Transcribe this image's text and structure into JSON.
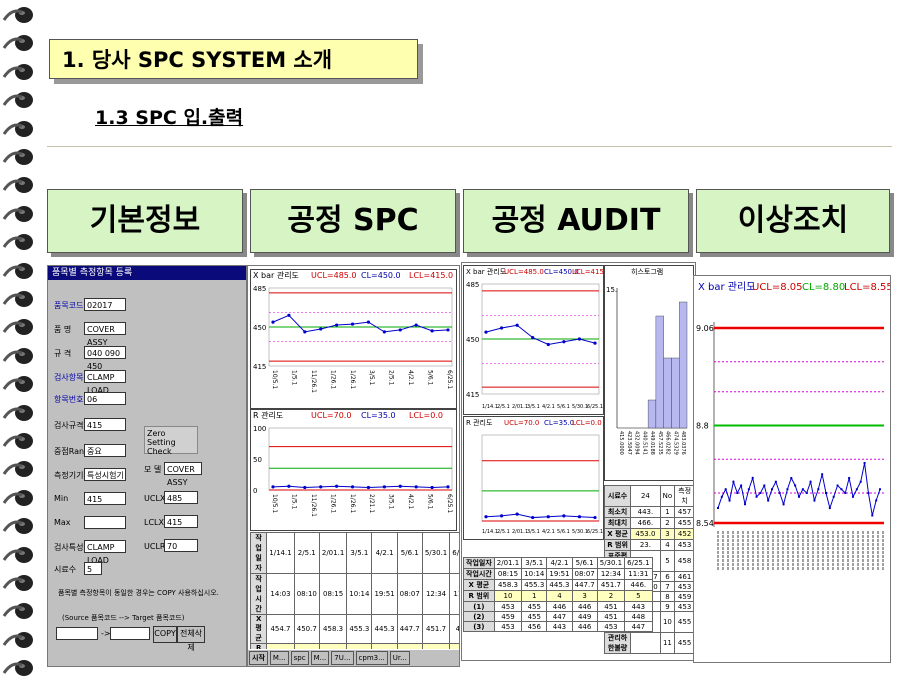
{
  "slide": {
    "title": "1. 당사 SPC SYSTEM 소개",
    "subtitle": "1.3  SPC 입.출력"
  },
  "categories": [
    "기본정보",
    "공정 SPC",
    "공정 AUDIT",
    "이상조치"
  ],
  "form": {
    "window_title": "품목별 측정항목 등록",
    "fields": [
      {
        "label": "품목코드",
        "value": "02017"
      },
      {
        "label": "품 명",
        "value": "COVER ASSY"
      },
      {
        "label": "규 격",
        "value": "040 090 450"
      },
      {
        "label": "검사항목",
        "value": "CLAMP LOAD"
      },
      {
        "label": "항목번호",
        "value": "06"
      },
      {
        "label": "검사규격",
        "value": "415"
      },
      {
        "label": "중점Rank",
        "value": "중요"
      },
      {
        "label": "측정기기",
        "value": "특성시험기"
      },
      {
        "label": "Min",
        "value": "415"
      },
      {
        "label": "Max",
        "value": ""
      },
      {
        "label": "검사특성",
        "value": "CLAMP LOAD"
      },
      {
        "label": "시료수",
        "value": "5"
      }
    ],
    "zero_check": "Zero Setting Check",
    "model_label": "모 델 명",
    "model_value": "COVER ASSY",
    "ucl_label": "UCLX",
    "ucl_value": "485",
    "lcl_label": "LCLX",
    "lcl_value": "415",
    "uclr_label": "UCLR",
    "uclr_value": "70",
    "note": "품목별 측정항목이 동일한 경우는 COPY 사용하십시오.",
    "copy_hint": "(Source 품목코드 --> Target 품목코드)",
    "arrow": "->",
    "copy_button": "COPY",
    "delete_button": "전체삭제"
  },
  "spc": {
    "xbar": {
      "title": "X bar 관리도",
      "ucl": "UCL=485.0",
      "cl": "CL=450.0",
      "lcl": "LCL=415.0",
      "y_ticks": [
        "485",
        "450",
        "415"
      ],
      "x_ticks": [
        "10/5.1",
        "1/5.1",
        "11/26.1",
        "1/26.1",
        "1/26.1",
        "3/5.1",
        "2/5.1",
        "4/2.1",
        "5/6.1",
        "6/25.1"
      ]
    },
    "r": {
      "title": "R 관리도",
      "ucl": "UCL=70.0",
      "cl": "CL=35.0",
      "lcl": "LCL=0.0",
      "y_ticks": [
        "100",
        "50",
        "0"
      ],
      "x_ticks": [
        "10/5.1",
        "1/5.1",
        "11/26.1",
        "1/26.1",
        "1/26.1",
        "2/21.1",
        "3/5.1",
        "4/2.1",
        "5/6.1",
        "6/25.1"
      ]
    },
    "table": {
      "rows": [
        [
          "작업일자",
          "1/14.1",
          "2/5.1",
          "2/01.1",
          "3/5.1",
          "4/2.1",
          "5/6.1",
          "5/30.1",
          "6/25.1"
        ],
        [
          "작업시간",
          "14:03",
          "08:10",
          "08:15",
          "10:14",
          "19:51",
          "08:07",
          "12:34",
          "11:31"
        ],
        [
          "X 평균",
          "454.7",
          "450.7",
          "458.3",
          "455.3",
          "445.3",
          "447.7",
          "451.7",
          "446."
        ],
        [
          "R 범위",
          "5",
          "5",
          "10",
          "1",
          "4",
          "3",
          "2",
          "5"
        ],
        [
          "(1)",
          "457",
          "453",
          "453",
          "455",
          "446",
          "446",
          "451",
          "443"
        ],
        [
          "(2)",
          "455",
          "458",
          "459",
          "455",
          "447",
          "449",
          "451",
          "448"
        ],
        [
          "(3)",
          "452",
          "461",
          "453",
          "456",
          "443",
          "446",
          "453",
          "447"
        ]
      ]
    },
    "taskbar": [
      "시작",
      "M...",
      "spc",
      "M...",
      "7U...",
      "cpm3...",
      "Ur..."
    ]
  },
  "audit": {
    "xbar": {
      "title": "X bar 관리도",
      "ucl": "UCL=485.0",
      "cl": "CL=450.0",
      "lcl": "LCL=415.0",
      "y_ticks": [
        "485",
        "450",
        "415"
      ],
      "x_ticks": [
        "1/14.1",
        "2/5.1",
        "2/01.1",
        "3/5.1",
        "4/2.1",
        "5/6.1",
        "5/30.1",
        "6/25.1"
      ]
    },
    "r": {
      "title": "R 관리도",
      "ucl": "UCL=70.0",
      "cl": "CL=35.0",
      "lcl": "LCL=0.0",
      "x_ticks": [
        "1/14.1",
        "2/5.1",
        "2/01.1",
        "3/5.1",
        "4/2.1",
        "5/6.1",
        "5/30.1",
        "6/25.1"
      ]
    },
    "hist": {
      "title": "히스토그램",
      "y_top": "15.",
      "x_ticks": [
        "415.0000",
        "423.5047",
        "432.0094",
        "440.5141",
        "449.0188",
        "457.5235",
        "466.0282",
        "474.5329",
        "483.0376"
      ]
    },
    "stats": [
      [
        "시료수",
        "24",
        "No",
        "측정치"
      ],
      [
        "최소치",
        "443.",
        "1",
        "457"
      ],
      [
        "최대치",
        "466.",
        "2",
        "455"
      ],
      [
        "X 평균",
        "453.0",
        "3",
        "452"
      ],
      [
        "R 범위",
        "23.",
        "4",
        "453"
      ],
      [
        "표준편차",
        "7.25",
        "5",
        "458"
      ],
      [
        "-3S",
        "431.87",
        "6",
        "461"
      ],
      [
        "+3S",
        "475.30",
        "7",
        "453"
      ],
      [
        "Cp",
        "1.78",
        "8",
        "459"
      ],
      [
        "Cpk",
        "",
        "9",
        "453"
      ],
      [
        "관리상한불량",
        "",
        "10",
        "455"
      ],
      [
        "관리하한불량",
        "",
        "11",
        "455"
      ]
    ],
    "table": {
      "rows": [
        [
          "작업일자",
          "2/01.1",
          "3/5.1",
          "4/2.1",
          "5/6.1",
          "5/30.1",
          "6/25.1"
        ],
        [
          "작업시간",
          "08:15",
          "10:14",
          "19:51",
          "08:07",
          "12:34",
          "11:31"
        ],
        [
          "X 평균",
          "458.3",
          "455.3",
          "445.3",
          "447.7",
          "451.7",
          "446."
        ],
        [
          "R 범위",
          "10",
          "1",
          "4",
          "3",
          "2",
          "5"
        ],
        [
          "(1)",
          "453",
          "455",
          "446",
          "446",
          "451",
          "443"
        ],
        [
          "(2)",
          "459",
          "455",
          "447",
          "449",
          "451",
          "448"
        ],
        [
          "(3)",
          "453",
          "456",
          "443",
          "446",
          "453",
          "447"
        ]
      ]
    }
  },
  "abnormal": {
    "title": "X bar 관리도",
    "ucl": "UCL=8.05",
    "cl": "CL=8.80",
    "lcl": "LCL=8.55",
    "y_ticks": [
      "9.06",
      "8.8",
      "8.54"
    ]
  },
  "chart_data": [
    {
      "type": "line",
      "title": "X bar 관리도",
      "ylim": [
        415,
        485
      ],
      "x": [
        "10/5.1",
        "1/5.1",
        "11/26.1",
        "1/26.1",
        "1/26.1",
        "3/5.1",
        "2/5.1",
        "4/2.1",
        "5/6.1",
        "6/25.1"
      ],
      "series": [
        {
          "values": [
            455,
            462,
            445,
            448,
            452,
            453,
            455,
            445,
            447,
            452,
            446,
            447
          ]
        }
      ]
    },
    {
      "type": "line",
      "title": "R 관리도",
      "ylim": [
        0,
        100
      ],
      "series": [
        {
          "values": [
            5,
            6,
            4,
            5,
            6,
            5,
            4,
            5,
            6,
            5,
            4,
            5
          ]
        }
      ]
    },
    {
      "type": "line",
      "title": "X bar 관리도",
      "ylim": [
        415,
        485
      ],
      "series": [
        {
          "values": [
            455,
            458,
            460,
            451,
            446,
            448,
            450,
            447
          ]
        }
      ]
    },
    {
      "type": "bar",
      "title": "히스토그램",
      "categories": [
        "415.0000",
        "423.5047",
        "432.0094",
        "440.5141",
        "449.0188",
        "457.5235",
        "466.0282",
        "474.5329",
        "483.0376"
      ],
      "values": [
        0,
        0,
        0,
        0,
        2,
        8,
        5,
        5,
        9
      ]
    },
    {
      "type": "line",
      "title": "X bar 관리도",
      "ylim": [
        8.54,
        9.06
      ],
      "series": [
        {
          "values": [
            8.58,
            8.61,
            8.63,
            8.6,
            8.65,
            8.62,
            8.64,
            8.59,
            8.63,
            8.66,
            8.61,
            8.62,
            8.64,
            8.6,
            8.63,
            8.65,
            8.62,
            8.59,
            8.63,
            8.66,
            8.64,
            8.61,
            8.63,
            8.62,
            8.65,
            8.6,
            8.63,
            8.67,
            8.62,
            8.58,
            8.61,
            8.64,
            8.63,
            8.62,
            8.66,
            8.61,
            8.63,
            8.65,
            8.7,
            8.62,
            8.56,
            8.6,
            8.63
          ]
        }
      ]
    }
  ]
}
